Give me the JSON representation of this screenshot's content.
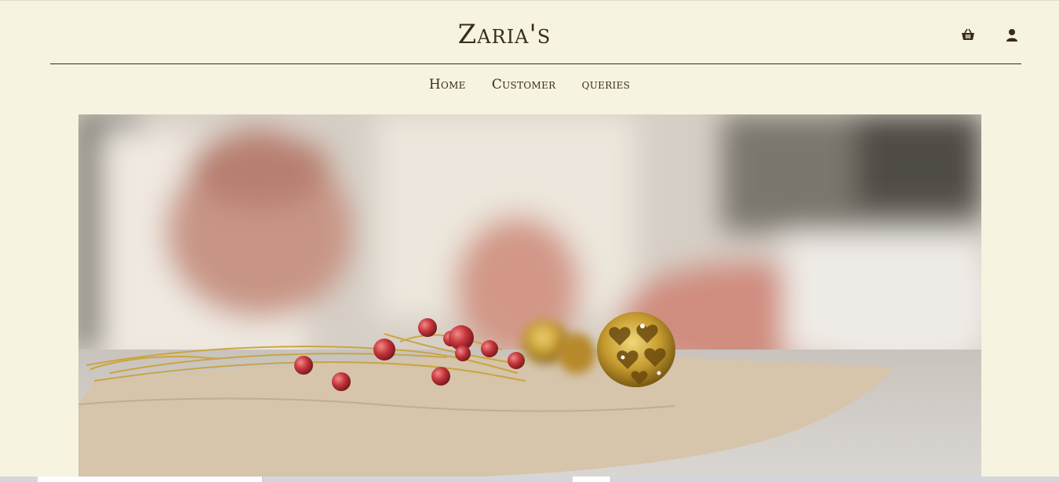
{
  "header": {
    "brand": "Zaria's",
    "icons": {
      "cart": "shopping-basket-icon",
      "user": "user-icon"
    }
  },
  "nav": {
    "items": [
      {
        "label": "Home"
      },
      {
        "label": "Customer"
      },
      {
        "label": "queries"
      }
    ]
  },
  "hero": {
    "description_icon": "jewelry-photo",
    "colors": {
      "background": "#f7f3e1",
      "text": "#3a2b1f",
      "gold": "#c9a43a",
      "coral": "#c4343a"
    }
  }
}
